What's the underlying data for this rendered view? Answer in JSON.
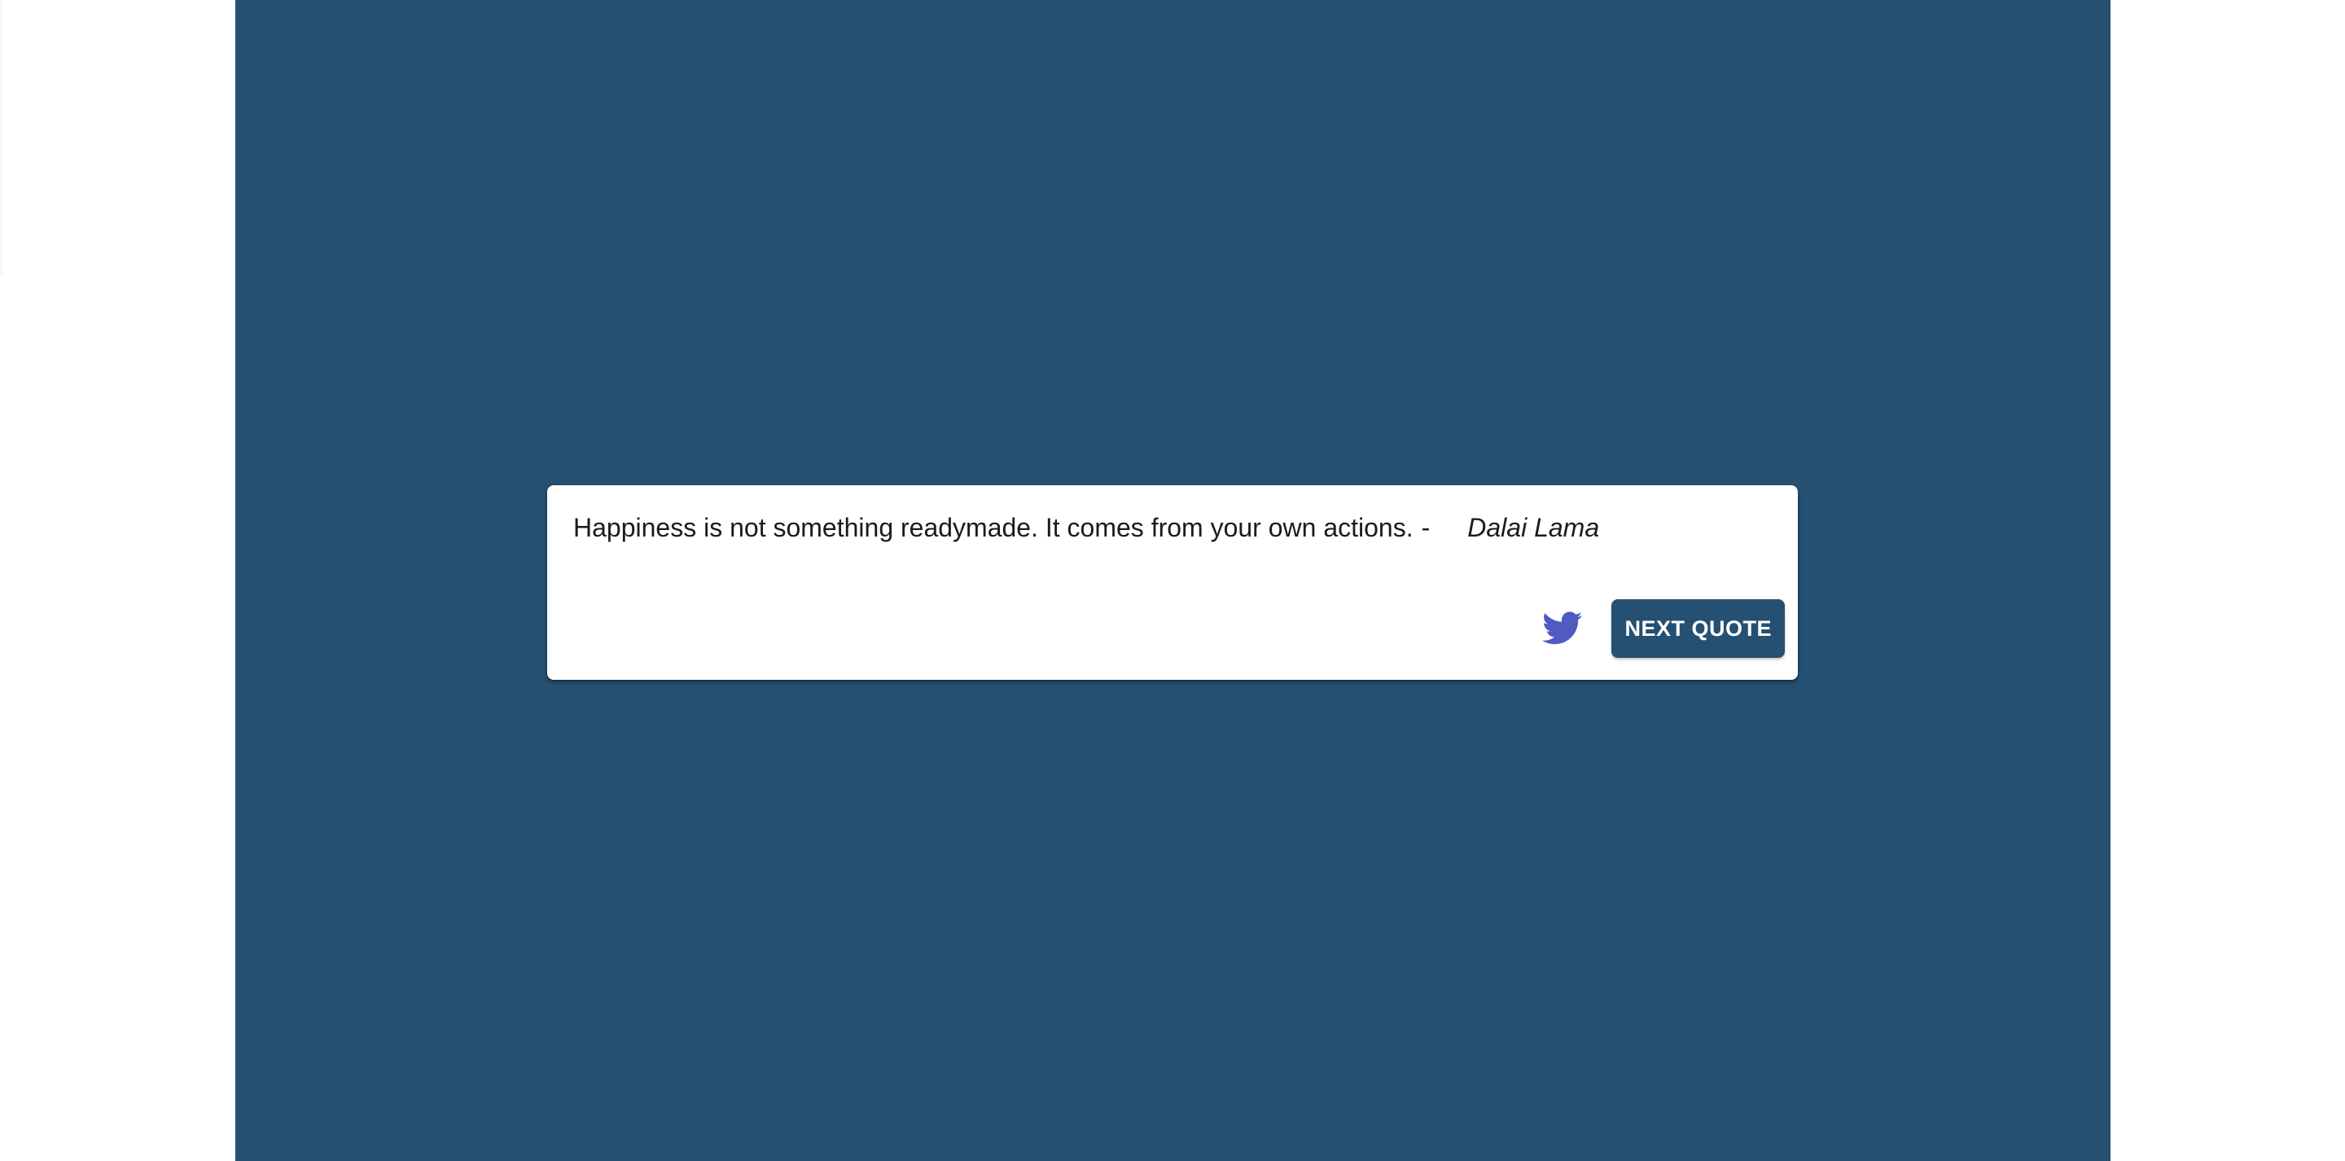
{
  "theme": {
    "background_color": "#255072",
    "card_color": "#ffffff",
    "twitter_icon_color": "#4f5bc2",
    "button_color": "#255072",
    "button_text_color": "#ffffff"
  },
  "quote": {
    "text": "Happiness is not something readymade. It comes from your own actions.",
    "separator": "-",
    "author": "Dalai Lama"
  },
  "actions": {
    "tweet_icon": "twitter-bird-icon",
    "next_label": "NEXT QUOTE"
  }
}
